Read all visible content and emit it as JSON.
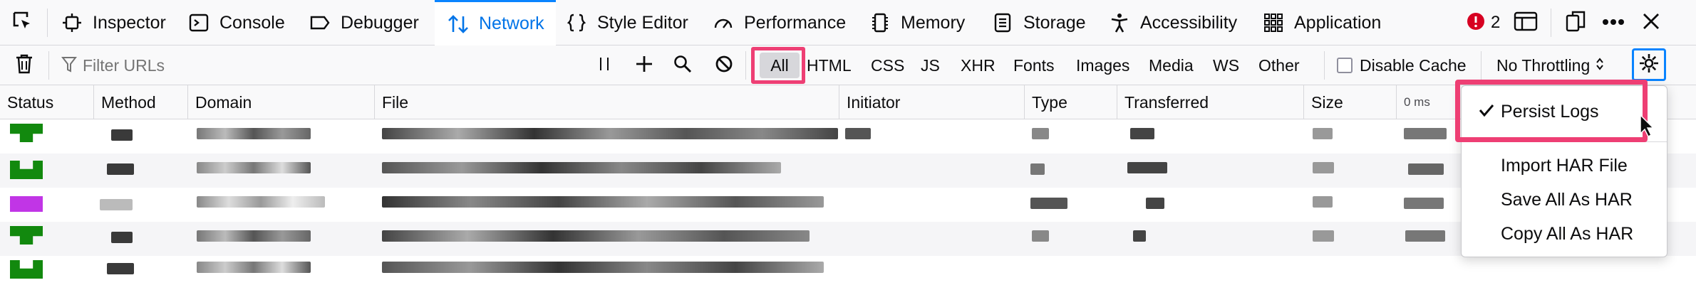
{
  "tabs": [
    {
      "label": "Inspector",
      "icon": "inspector-icon"
    },
    {
      "label": "Console",
      "icon": "console-icon"
    },
    {
      "label": "Debugger",
      "icon": "debugger-icon"
    },
    {
      "label": "Network",
      "icon": "network-icon",
      "selected": true
    },
    {
      "label": "Style Editor",
      "icon": "style-editor-icon"
    },
    {
      "label": "Performance",
      "icon": "performance-icon"
    },
    {
      "label": "Memory",
      "icon": "memory-icon"
    },
    {
      "label": "Storage",
      "icon": "storage-icon"
    },
    {
      "label": "Accessibility",
      "icon": "accessibility-icon"
    },
    {
      "label": "Application",
      "icon": "application-icon"
    }
  ],
  "error_count": "2",
  "toolbar": {
    "filter_placeholder": "Filter URLs",
    "types": [
      "All",
      "HTML",
      "CSS",
      "JS",
      "XHR",
      "Fonts",
      "Images",
      "Media",
      "WS",
      "Other"
    ],
    "active_type": "All",
    "disable_cache_label": "Disable Cache",
    "throttling_label": "No Throttling"
  },
  "columns": [
    "Status",
    "Method",
    "Domain",
    "File",
    "Initiator",
    "Type",
    "Transferred",
    "Size",
    "0 ms"
  ],
  "menu": {
    "items": [
      {
        "label": "Persist Logs",
        "checked": true
      },
      {
        "label": "Import HAR File"
      },
      {
        "label": "Save All As HAR"
      },
      {
        "label": "Copy All As HAR"
      }
    ]
  },
  "colors": {
    "accent": "#0a84ff",
    "highlight": "#ee3f74",
    "status_ok": "#12890e",
    "status_other": "#c135e6"
  }
}
